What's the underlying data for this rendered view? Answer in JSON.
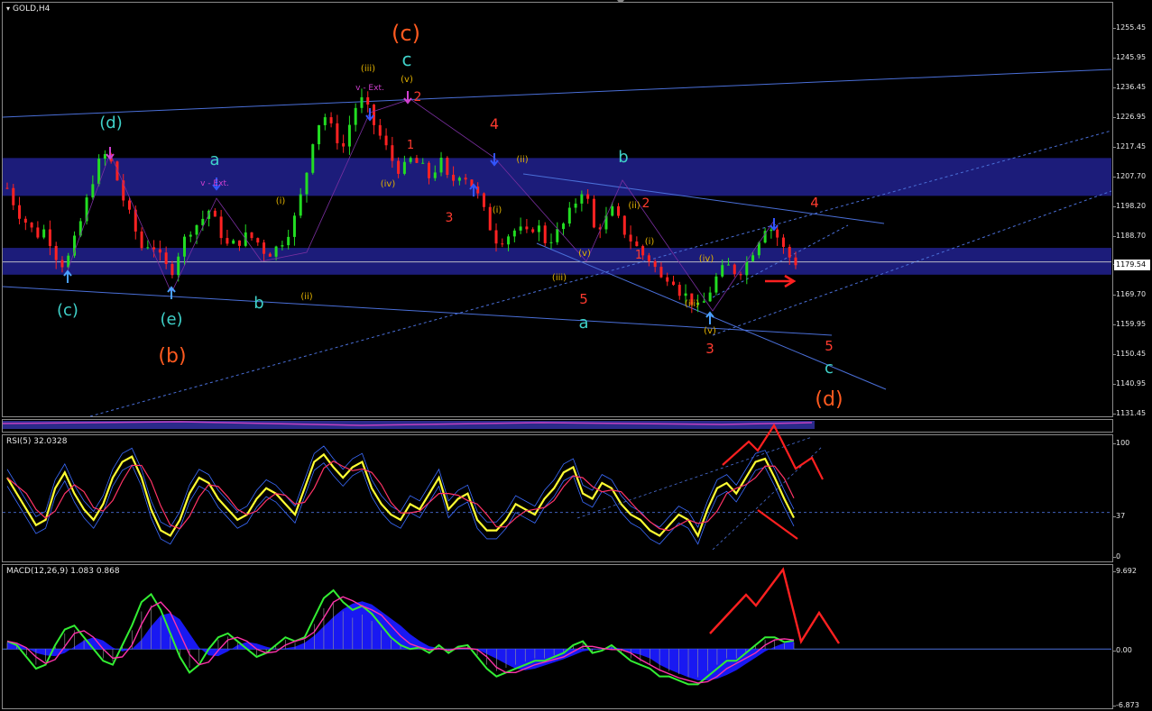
{
  "window": {
    "title": "GOLD,H4",
    "current_price": "1179.54"
  },
  "colors": {
    "background": "#000000",
    "bull_candle": "#22dd22",
    "bear_candle": "#ff2222",
    "zone_fill": "#1c1c7a",
    "trend_line": "#4a6fd8",
    "wave_cyan": "#3fd1c9",
    "wave_orange": "#ff5a1f",
    "wave_red": "#ff3b2f",
    "wave_magenta": "#d040d0",
    "wave_yellow": "#e0b000",
    "rsi_main": "#ffff33",
    "rsi_ma": "#ff3366",
    "rsi_band": "#3a6bff",
    "macd_hist": "#1a1aff",
    "macd_line": "#33ee33",
    "macd_signal": "#ff33aa"
  },
  "main_axis": {
    "ticks": [
      "1255.45",
      "1245.95",
      "1236.45",
      "1226.95",
      "1217.45",
      "1207.70",
      "1198.20",
      "1188.70",
      "1179.54",
      "1169.70",
      "1159.95",
      "1150.45",
      "1140.95",
      "1131.45"
    ]
  },
  "rsi": {
    "title": "RSI(5) 32.0328",
    "ticks": [
      "100",
      "37",
      "0"
    ]
  },
  "macd": {
    "title": "MACD(12,26,9) 1.083 0.868",
    "ticks": [
      "9.692",
      "0.00",
      "-6.873"
    ]
  },
  "wave_labels": {
    "big_c": "(c)",
    "big_b": "(b)",
    "big_d": "(d)",
    "cyan_c_top": "c",
    "cyan_d": "(d)",
    "cyan_a1": "a",
    "cyan_c1": "(c)",
    "cyan_e": "(e)",
    "cyan_b1": "b",
    "cyan_b2": "b",
    "cyan_a2": "a",
    "cyan_c2": "c",
    "red_2": "2",
    "red_4": "4",
    "red_3a": "3",
    "red_5a": "5",
    "red_2b": "2",
    "red_1b": "1",
    "red_3b": "3",
    "red_5b": "5",
    "red_4b": "4",
    "red_1a": "1",
    "ext1": "v - Ext.",
    "ext2": "v - Ext.",
    "y_iii": "(iii)",
    "y_v": "(v)",
    "y_iv": "(iv)",
    "y_i": "(i)",
    "y_ii": "(ii)",
    "y_ii2": "(ii)",
    "y_i2": "(i)",
    "y_iii2": "(iii)",
    "y_v2": "(v)",
    "y_ii3": "(ii)",
    "y_i3": "(i)",
    "y_iv3": "(iv)",
    "y_iii3": "(iii)",
    "y_v3": "(v)",
    "y_ii4": "(ii)"
  },
  "chart_data": [
    {
      "type": "candlestick",
      "title": "GOLD,H4",
      "ylim": [
        1131.45,
        1255.45
      ],
      "last_price": 1179.54,
      "zones": [
        {
          "from": 1200.5,
          "to": 1212.5
        },
        {
          "from": 1175.5,
          "to": 1184.0
        }
      ],
      "close_path": [
        1203,
        1196,
        1192,
        1188,
        1190,
        1182,
        1178,
        1186,
        1196,
        1207,
        1214,
        1210,
        1200,
        1192,
        1184,
        1186,
        1180,
        1176,
        1184,
        1190,
        1192,
        1196,
        1190,
        1184,
        1186,
        1188,
        1186,
        1182,
        1184,
        1188,
        1194,
        1206,
        1222,
        1226,
        1220,
        1216,
        1228,
        1231,
        1224,
        1218,
        1212,
        1208,
        1212,
        1210,
        1206,
        1212,
        1204,
        1208,
        1206,
        1200,
        1192,
        1186,
        1188,
        1190,
        1188,
        1192,
        1186,
        1188,
        1192,
        1198,
        1204,
        1190,
        1192,
        1196,
        1190,
        1186,
        1182,
        1180,
        1174,
        1176,
        1170,
        1168,
        1164,
        1170,
        1176,
        1178,
        1176,
        1180,
        1186,
        1192,
        1188,
        1182,
        1179.5
      ],
      "annotations": [
        "(c)",
        "(b)",
        "(d)",
        "c",
        "(d)",
        "a",
        "(c)",
        "(e)",
        "b",
        "a",
        "c",
        "1",
        "2",
        "3",
        "4",
        "5",
        "v - Ext."
      ]
    },
    {
      "type": "line",
      "title": "RSI(5) 32.0328",
      "ylim": [
        0,
        100
      ],
      "level": 37,
      "series": [
        {
          "values": [
            70,
            55,
            40,
            25,
            30,
            60,
            75,
            55,
            40,
            30,
            45,
            70,
            85,
            90,
            70,
            40,
            20,
            15,
            30,
            55,
            70,
            65,
            50,
            40,
            30,
            35,
            50,
            60,
            55,
            45,
            35,
            60,
            85,
            92,
            80,
            70,
            80,
            85,
            60,
            45,
            35,
            30,
            45,
            40,
            55,
            70,
            40,
            50,
            55,
            30,
            20,
            20,
            30,
            45,
            40,
            35,
            50,
            60,
            75,
            80,
            55,
            50,
            65,
            60,
            45,
            35,
            30,
            20,
            15,
            25,
            35,
            30,
            15,
            40,
            60,
            65,
            55,
            70,
            85,
            88,
            70,
            50,
            32
          ]
        }
      ]
    },
    {
      "type": "line",
      "title": "MACD(12,26,9) 1.083 0.868",
      "ylim": [
        -6.873,
        9.692
      ],
      "series": [
        {
          "values": [
            1,
            0.5,
            -1,
            -2.5,
            -2,
            0.5,
            2.5,
            3,
            1.5,
            0,
            -1.5,
            -2,
            0.5,
            3,
            6,
            7,
            5,
            2,
            -1,
            -3,
            -2,
            0,
            1.5,
            2,
            1,
            0,
            -1,
            -0.5,
            0.5,
            1.5,
            1,
            1.5,
            4,
            6.5,
            7.5,
            6,
            5,
            5.5,
            4.5,
            3,
            1.5,
            0.5,
            0,
            0.2,
            -0.5,
            0.5,
            -0.5,
            0.3,
            0.5,
            -1,
            -2.5,
            -3.5,
            -3,
            -2.5,
            -2,
            -1.5,
            -1.5,
            -1,
            -0.5,
            0.5,
            1,
            -0.5,
            -0.2,
            0.5,
            -0.5,
            -1.5,
            -2,
            -2.5,
            -3.5,
            -3.5,
            -4,
            -4.5,
            -4.5,
            -3.5,
            -2.5,
            -1.5,
            -1.5,
            -0.5,
            0.5,
            1.5,
            1.5,
            0.9,
            1.083
          ]
        }
      ]
    }
  ]
}
